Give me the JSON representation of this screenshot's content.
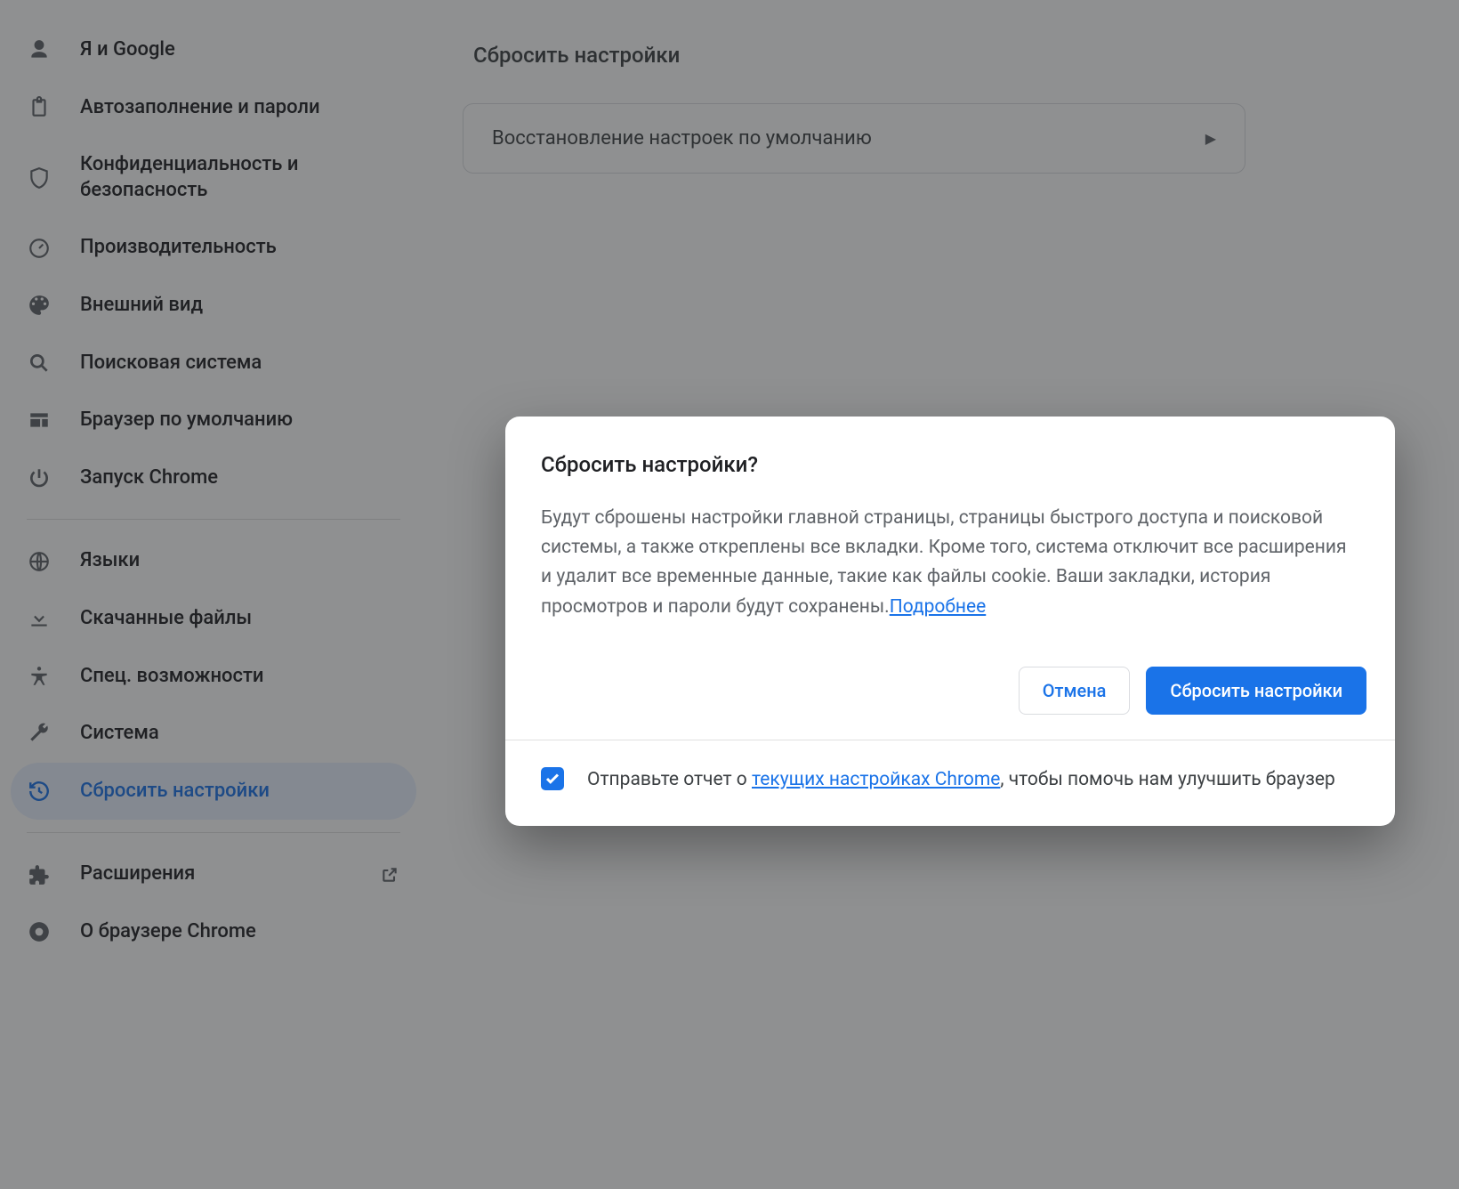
{
  "sidebar": {
    "items": [
      {
        "label": "Я и Google"
      },
      {
        "label": "Автозаполнение и пароли"
      },
      {
        "label": "Конфиденциальность и безопасность"
      },
      {
        "label": "Производительность"
      },
      {
        "label": "Внешний вид"
      },
      {
        "label": "Поисковая система"
      },
      {
        "label": "Браузер по умолчанию"
      },
      {
        "label": "Запуск Chrome"
      }
    ],
    "items2": [
      {
        "label": "Языки"
      },
      {
        "label": "Скачанные файлы"
      },
      {
        "label": "Спец. возможности"
      },
      {
        "label": "Система"
      },
      {
        "label": "Сбросить настройки"
      }
    ],
    "items3": [
      {
        "label": "Расширения"
      },
      {
        "label": "О браузере Chrome"
      }
    ]
  },
  "main": {
    "section_title": "Сбросить настройки",
    "row_label": "Восстановление настроек по умолчанию"
  },
  "dialog": {
    "title": "Сбросить настройки?",
    "body_text": "Будут сброшены настройки главной страницы, страницы быстрого доступа и поисковой системы, а также откреплены все вкладки. Кроме того, система отключит все расширения и удалит все временные данные, такие как файлы cookie. Ваши закладки, история просмотров и пароли будут сохранены.",
    "learn_more": "Подробнее",
    "cancel": "Отмена",
    "confirm": "Сбросить настройки",
    "footer_pre": "Отправьте отчет о ",
    "footer_link": "текущих настройках Chrome",
    "footer_post": ", чтобы помочь нам улучшить браузер",
    "checkbox_checked": true
  }
}
